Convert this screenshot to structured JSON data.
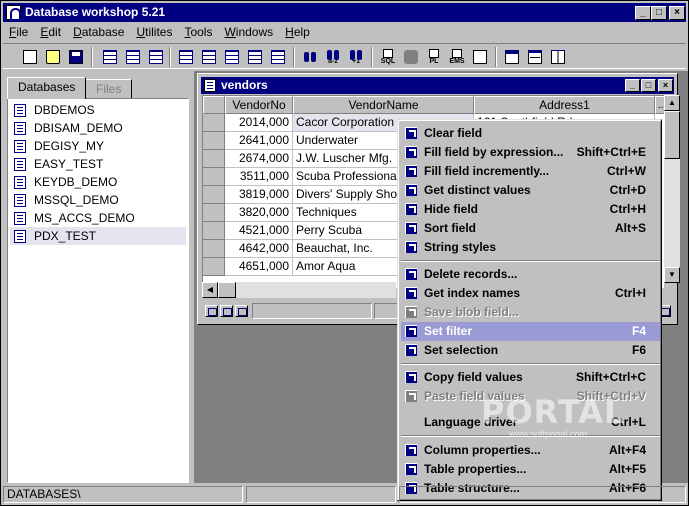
{
  "app": {
    "title": "Database workshop 5.21"
  },
  "menu": [
    "File",
    "Edit",
    "Database",
    "Utilites",
    "Tools",
    "Windows",
    "Help"
  ],
  "toolbar": {
    "buttons": [
      "new-icon",
      "open-icon",
      "save-icon",
      "grid-icon",
      "grid-icon",
      "grid-icon",
      "grid-icon",
      "grid-icon",
      "grid-icon",
      "grid-icon",
      "grid-icon",
      "binoculars-icon",
      "binoculars-icon",
      "binoculars-icon",
      "sql-icon",
      "comment-icon",
      "pl-icon",
      "ems-icon",
      "export-icon",
      "window-icon",
      "split-horizontal-icon",
      "split-vertical-icon"
    ],
    "sub_labels": {
      "sort_az": "a-z",
      "sort_plus1": "+1",
      "sql": "SQL",
      "pl": "PL",
      "ems": "EMS"
    }
  },
  "left_panel": {
    "tabs": [
      {
        "label": "Databases",
        "active": true
      },
      {
        "label": "Files",
        "active": false
      }
    ],
    "databases": [
      "DBDEMOS",
      "DBISAM_DEMO",
      "DEGISY_MY",
      "EASY_TEST",
      "KEYDB_DEMO",
      "MSSQL_DEMO",
      "MS_ACCS_DEMO",
      "PDX_TEST"
    ],
    "selected": "PDX_TEST"
  },
  "child_window": {
    "title": "vendors",
    "columns": [
      "VendorNo",
      "VendorName",
      "Address1"
    ],
    "rows": [
      {
        "vendor_no": "2014,000",
        "vendor_name": "Cacor Corporation",
        "address1": "161 Southfield Rd"
      },
      {
        "vendor_no": "2641,000",
        "vendor_name": "Underwater",
        "address1": ""
      },
      {
        "vendor_no": "2674,000",
        "vendor_name": "J.W.  Luscher Mfg.",
        "address1": ""
      },
      {
        "vendor_no": "3511,000",
        "vendor_name": "Scuba Professionals",
        "address1": ""
      },
      {
        "vendor_no": "3819,000",
        "vendor_name": "Divers'  Supply Shop",
        "address1": ""
      },
      {
        "vendor_no": "3820,000",
        "vendor_name": "Techniques",
        "address1": ""
      },
      {
        "vendor_no": "4521,000",
        "vendor_name": "Perry Scuba",
        "address1": ""
      },
      {
        "vendor_no": "4642,000",
        "vendor_name": "Beauchat, Inc.",
        "address1": ""
      },
      {
        "vendor_no": "4651,000",
        "vendor_name": "Amor Aqua",
        "address1": ""
      }
    ],
    "header_ellipsis": "..."
  },
  "context_menu": {
    "groups": [
      [
        {
          "label": "Clear field",
          "shortcut": "",
          "disabled": false
        },
        {
          "label": "Fill field by expression...",
          "shortcut": "Shift+Ctrl+E",
          "disabled": false
        },
        {
          "label": "Fill field incremently...",
          "shortcut": "Ctrl+W",
          "disabled": false
        },
        {
          "label": "Get distinct values",
          "shortcut": "Ctrl+D",
          "disabled": false
        },
        {
          "label": "Hide field",
          "shortcut": "Ctrl+H",
          "disabled": false
        },
        {
          "label": "Sort field",
          "shortcut": "Alt+S",
          "disabled": false
        },
        {
          "label": "String styles",
          "shortcut": "",
          "disabled": false
        }
      ],
      [
        {
          "label": "Delete records...",
          "shortcut": "",
          "disabled": false
        },
        {
          "label": "Get index names",
          "shortcut": "Ctrl+I",
          "disabled": false
        },
        {
          "label": "Save blob field...",
          "shortcut": "",
          "disabled": true
        },
        {
          "label": "Set filter",
          "shortcut": "F4",
          "disabled": false,
          "highlighted": true
        },
        {
          "label": "Set selection",
          "shortcut": "F6",
          "disabled": false
        }
      ],
      [
        {
          "label": "Copy field values",
          "shortcut": "Shift+Ctrl+C",
          "disabled": false
        },
        {
          "label": "Paste field values",
          "shortcut": "Shift+Ctrl+V",
          "disabled": true
        },
        {
          "label": "Language driver",
          "shortcut": "Ctrl+L",
          "disabled": false
        }
      ],
      [
        {
          "label": "Column properties...",
          "shortcut": "Alt+F4",
          "disabled": false
        },
        {
          "label": "Table properties...",
          "shortcut": "Alt+F5",
          "disabled": false
        },
        {
          "label": "Table structure...",
          "shortcut": "Alt+F6",
          "disabled": false
        }
      ]
    ]
  },
  "watermark": {
    "text": "PORTAL",
    "sub": "www.softportal.com"
  },
  "statusbar": {
    "path": "DATABASES\\"
  },
  "colors": {
    "title_bar": "#000080",
    "menu_highlight": "#9a9ad4",
    "face": "#c0c0c0",
    "mdi_background": "#808080"
  }
}
